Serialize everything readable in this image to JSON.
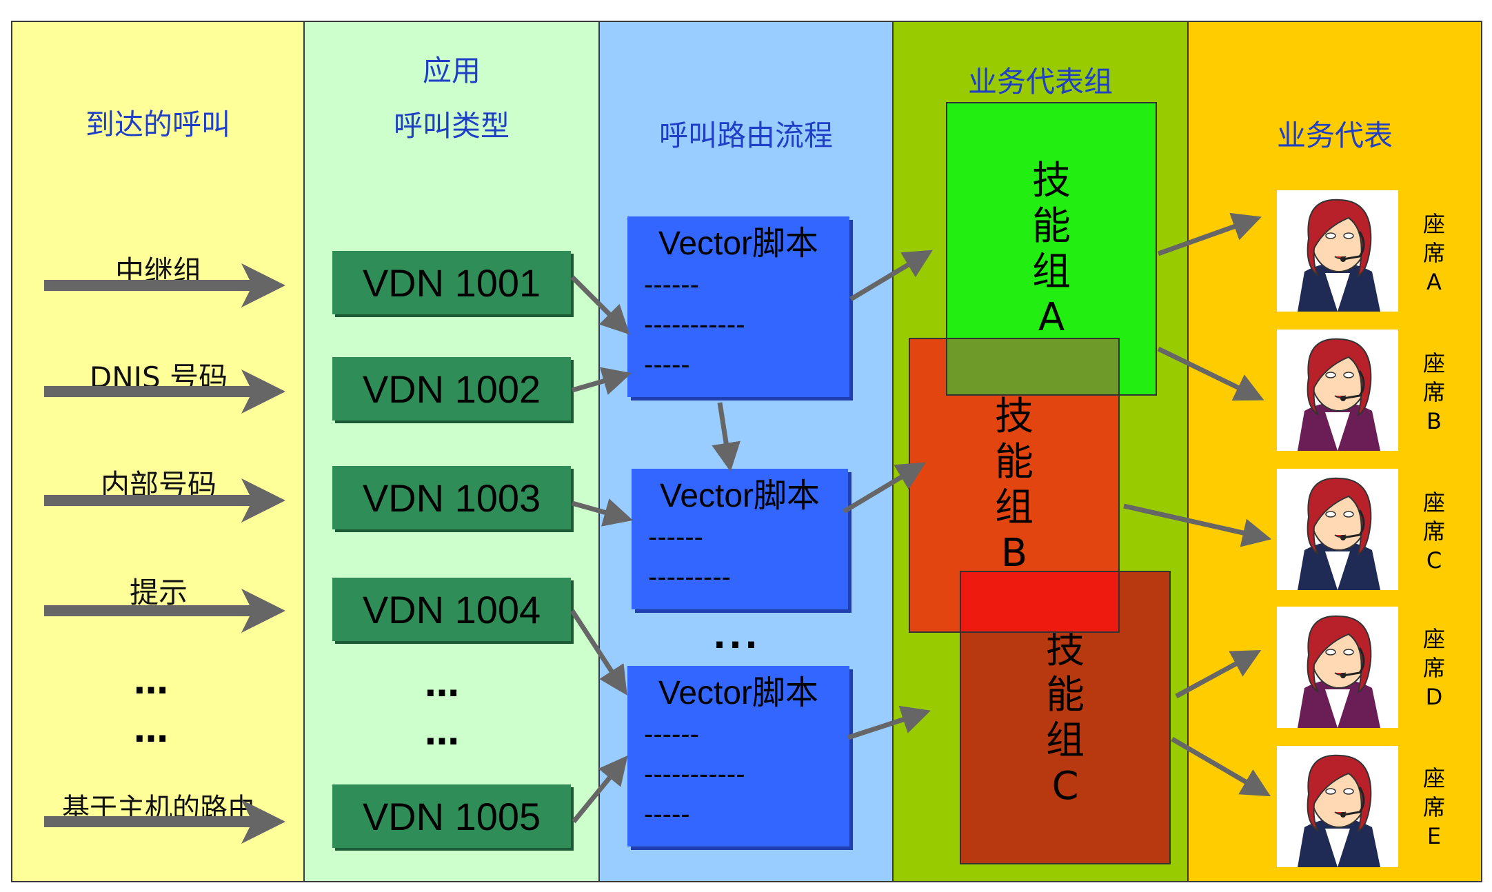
{
  "columns": {
    "arriving_calls": {
      "title": "到达的呼叫"
    },
    "call_types": {
      "title_line1": "应用",
      "title_line2": "呼叫类型"
    },
    "routing": {
      "title": "呼叫路由流程"
    },
    "agent_groups": {
      "title": "业务代表组"
    },
    "agents": {
      "title": "业务代表"
    }
  },
  "arriving": [
    "中继组",
    "DNIS 号码",
    "内部号码",
    "提示",
    "基于主机的路由"
  ],
  "ellipsis": "…",
  "ellipsis_mid": "...",
  "vdns": [
    "VDN 1001",
    "VDN 1002",
    "VDN 1003",
    "VDN 1004",
    "VDN 1005"
  ],
  "scripts": [
    {
      "title": "Vector脚本",
      "lines": [
        "------",
        "-----------",
        "-----"
      ]
    },
    {
      "title": "Vector脚本",
      "lines": [
        "------",
        "---------"
      ]
    },
    {
      "title": "Vector脚本",
      "lines": [
        "------",
        "-----------",
        "-----"
      ]
    }
  ],
  "skills": [
    {
      "chars": [
        "技",
        "能",
        "组",
        "A"
      ],
      "color": "#22ee11"
    },
    {
      "chars": [
        "技",
        "能",
        "组",
        "B"
      ],
      "color": "#e83a10"
    },
    {
      "chars": [
        "技",
        "能",
        "组",
        "C"
      ],
      "color": "#b83810"
    }
  ],
  "seats": [
    [
      "座",
      "席",
      "A"
    ],
    [
      "座",
      "席",
      "B"
    ],
    [
      "座",
      "席",
      "C"
    ],
    [
      "座",
      "席",
      "D"
    ],
    [
      "座",
      "席",
      "E"
    ]
  ],
  "colors": {
    "col1": "#ffff99",
    "col2": "#ccffcc",
    "col3": "#99ccff",
    "col4": "#99cc00",
    "col5": "#ffcc00",
    "vdn": "#2f8d58",
    "script": "#3366ff",
    "arrow": "#666666",
    "title_text": "#1f3fc7"
  }
}
